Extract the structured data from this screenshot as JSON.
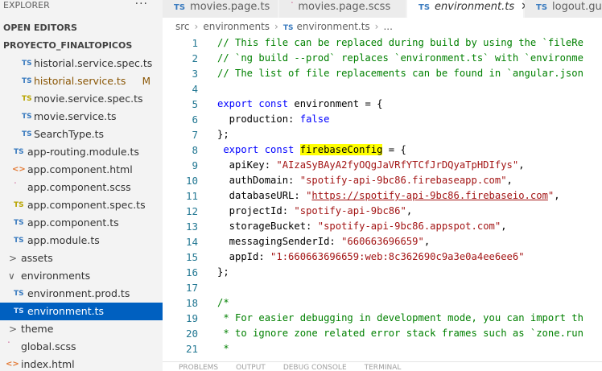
{
  "explorer": {
    "title": "EXPLORER",
    "more": "···",
    "open_editors": "OPEN EDITORS",
    "project": "PROYECTO_FINALTOPICOS",
    "files": [
      {
        "name": "historial.service.spec.ts",
        "icon": "TS",
        "badge": ""
      },
      {
        "name": "historial.service.ts",
        "icon": "TS",
        "badge": "M"
      },
      {
        "name": "movie.service.spec.ts",
        "icon": "TS",
        "badge": ""
      },
      {
        "name": "movie.service.ts",
        "icon": "TS",
        "badge": ""
      },
      {
        "name": "SearchType.ts",
        "icon": "TS",
        "badge": ""
      },
      {
        "name": "app-routing.module.ts",
        "icon": "TS",
        "badge": ""
      },
      {
        "name": "app.component.html",
        "icon": "<>",
        "badge": ""
      },
      {
        "name": "app.component.scss",
        "icon": "ᐝ",
        "badge": ""
      },
      {
        "name": "app.component.spec.ts",
        "icon": "TS",
        "badge": ""
      },
      {
        "name": "app.component.ts",
        "icon": "TS",
        "badge": ""
      },
      {
        "name": "app.module.ts",
        "icon": "TS",
        "badge": ""
      },
      {
        "name": "assets",
        "icon": ">",
        "badge": ""
      },
      {
        "name": "environments",
        "icon": "∨",
        "badge": ""
      },
      {
        "name": "environment.prod.ts",
        "icon": "TS",
        "badge": ""
      },
      {
        "name": "environment.ts",
        "icon": "TS",
        "badge": ""
      },
      {
        "name": "theme",
        "icon": ">",
        "badge": ""
      },
      {
        "name": "global.scss",
        "icon": "ᐝ",
        "badge": ""
      },
      {
        "name": "index.html",
        "icon": "<>",
        "badge": ""
      }
    ]
  },
  "tabs": [
    {
      "label": "movies.page.ts",
      "icon": "TS"
    },
    {
      "label": "movies.page.scss",
      "icon": "ᐝ"
    },
    {
      "label": "environment.ts",
      "icon": "TS",
      "close": "✕"
    },
    {
      "label": "logout.guar",
      "icon": "TS"
    }
  ],
  "breadcrumb": {
    "parts": [
      "src",
      "environments",
      "environment.ts",
      "..."
    ],
    "sep": "›"
  },
  "code": {
    "line_numbers": [
      "1",
      "2",
      "3",
      "4",
      "5",
      "6",
      "7",
      "8",
      "9",
      "10",
      "11",
      "12",
      "13",
      "14",
      "15",
      "16",
      "17",
      "18",
      "19",
      "20",
      "21"
    ],
    "l1": "// This file can be replaced during build by using the `fileRe",
    "l2": "// `ng build --prod` replaces `environment.ts` with `environme",
    "l3": "// The list of file replacements can be found in `angular.json",
    "l5_kw": "export const",
    "l5_rest": " environment = {",
    "l6_prop": "  production: ",
    "l6_val": "false",
    "l7": "};",
    "l8_kw": " export const",
    "l8_name": "firebaseConfig",
    "l8_rest": " = {",
    "l9_prop": "  apiKey: ",
    "l9_val": "\"AIzaSyBAyA2fyOQgJaVRfYTCfJrDQyaTpHDIfys\"",
    "l9_end": ",",
    "l10_prop": "  authDomain: ",
    "l10_val": "\"spotify-api-9bc86.firebaseapp.com\"",
    "l10_end": ",",
    "l11_prop": "  databaseURL: ",
    "l11_q1": "\"",
    "l11_url": "https://spotify-api-9bc86.firebaseio.com",
    "l11_q2": "\"",
    "l11_end": ",",
    "l12_prop": "  projectId: ",
    "l12_val": "\"spotify-api-9bc86\"",
    "l12_end": ",",
    "l13_prop": "  storageBucket: ",
    "l13_val": "\"spotify-api-9bc86.appspot.com\"",
    "l13_end": ",",
    "l14_prop": "  messagingSenderId: ",
    "l14_val": "\"660663696659\"",
    "l14_end": ",",
    "l15_prop": "  appId: ",
    "l15_val": "\"1:660663696659:web:8c362690c9a3e0a4ee6ee6\"",
    "l16": "};",
    "l18": "/*",
    "l19": " * For easier debugging in development mode, you can import th",
    "l20": " * to ignore zone related error stack frames such as `zone.run",
    "l21": " *"
  },
  "panel_tabs": [
    "PROBLEMS",
    "OUTPUT",
    "DEBUG CONSOLE",
    "TERMINAL"
  ]
}
